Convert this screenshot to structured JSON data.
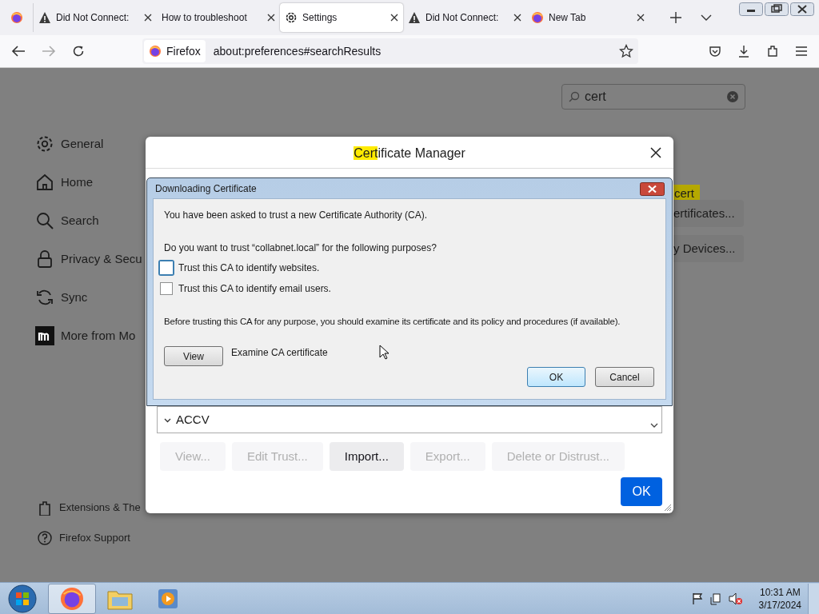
{
  "tabs": [
    {
      "kind": "firefox",
      "selected": false
    },
    {
      "kind": "warning",
      "label": "Did Not Connect:",
      "selected": false
    },
    {
      "kind": "none",
      "label": "How to troubleshoot",
      "selected": false
    },
    {
      "kind": "gear",
      "label": "Settings",
      "selected": true
    },
    {
      "kind": "warning",
      "label": "Did Not Connect:",
      "selected": false
    },
    {
      "kind": "firefox",
      "label": "New Tab",
      "selected": false
    }
  ],
  "urlbar": {
    "identity": "Firefox",
    "url": "about:preferences#searchResults"
  },
  "settings_search": {
    "value": "cert"
  },
  "sidebar": {
    "items": [
      {
        "kind": "gear",
        "label": "General"
      },
      {
        "kind": "home",
        "label": "Home"
      },
      {
        "kind": "search",
        "label": "Search"
      },
      {
        "kind": "lock",
        "label": "Privacy & Secu"
      },
      {
        "kind": "sync",
        "label": "Sync"
      },
      {
        "kind": "mozilla",
        "label": "More from Mo"
      }
    ],
    "footer": [
      {
        "kind": "puzzle",
        "label": "Extensions & The"
      },
      {
        "kind": "help",
        "label": "Firefox Support"
      }
    ]
  },
  "background": {
    "search_tooltip": "cert",
    "buttons": [
      "ertificates...",
      "y Devices..."
    ]
  },
  "certificate_manager": {
    "title_highlight": "Cert",
    "title_rest": "ificate Manager",
    "list_row": {
      "label": "ACCV",
      "expanded": true
    },
    "buttons": [
      {
        "label": "View...",
        "disabled": true
      },
      {
        "label": "Edit Trust...",
        "disabled": true
      },
      {
        "label": "Import...",
        "disabled": false
      },
      {
        "label": "Export...",
        "disabled": true
      },
      {
        "label": "Delete or Distrust...",
        "disabled": true
      }
    ],
    "ok": "OK"
  },
  "download_dialog": {
    "title": "Downloading Certificate",
    "intro": "You have been asked to trust a new Certificate Authority (CA).",
    "question": "Do you want to trust “collabnet.local” for the following purposes?",
    "options": [
      {
        "label": "Trust this CA to identify websites.",
        "checked": false,
        "focused": true
      },
      {
        "label": "Trust this CA to identify email users.",
        "checked": false,
        "focused": false
      }
    ],
    "advice": "Before trusting this CA for any purpose, you should examine its certificate and its policy and procedures (if available).",
    "view_button": "View",
    "view_caption": "Examine CA certificate",
    "ok": "OK",
    "cancel": "Cancel"
  },
  "taskbar": {
    "apps": [
      {
        "kind": "firefox",
        "selected": true
      },
      {
        "kind": "folder",
        "selected": false
      },
      {
        "kind": "media",
        "selected": false
      }
    ],
    "time": "10:31 AM",
    "date": "3/17/2024"
  }
}
